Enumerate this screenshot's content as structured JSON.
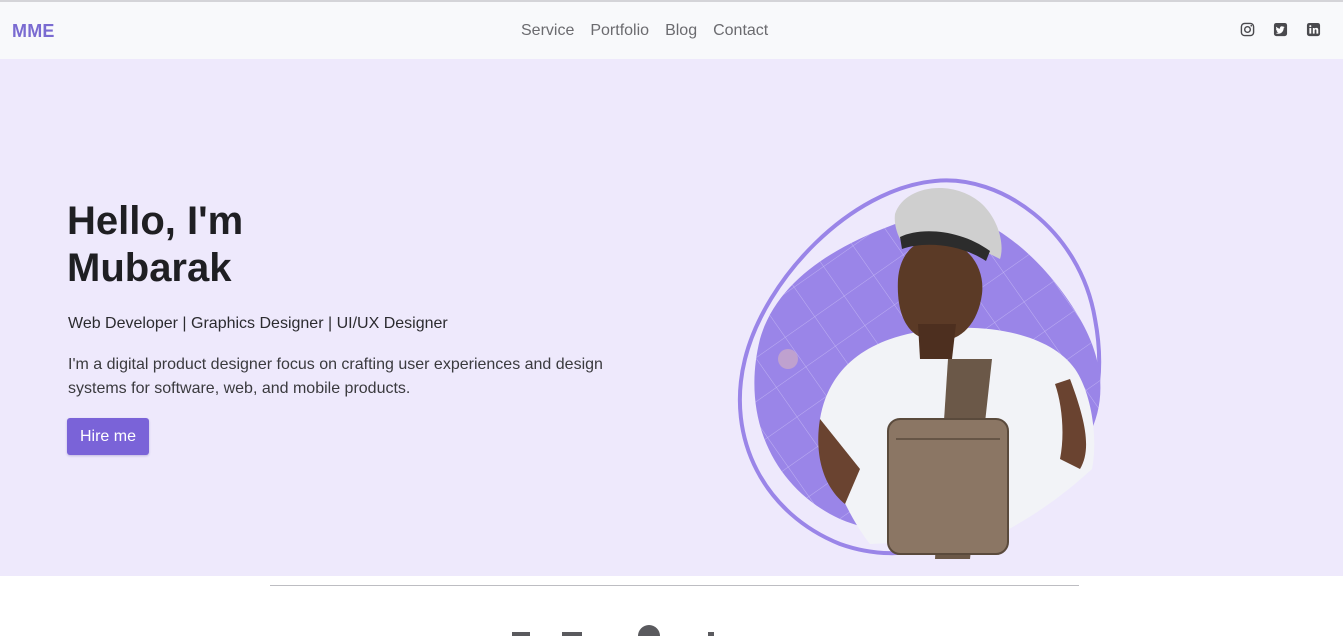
{
  "nav": {
    "brand": "MME",
    "links": [
      "Service",
      "Portfolio",
      "Blog",
      "Contact"
    ],
    "socials": [
      "instagram-icon",
      "twitter-icon",
      "linkedin-icon"
    ]
  },
  "hero": {
    "title": "Hello, I'm Mubarak",
    "roles": "Web Developer | Graphics Designer | UI/UX Designer",
    "description": "I'm a digital product designer focus on crafting user experiences and design systems for software, web, and mobile products.",
    "button": "Hire me"
  },
  "colors": {
    "brand": "#7a6bd1",
    "hero_bg": "#eee9fc",
    "accent": "#7a63d8",
    "blob": "#9a85e8"
  }
}
